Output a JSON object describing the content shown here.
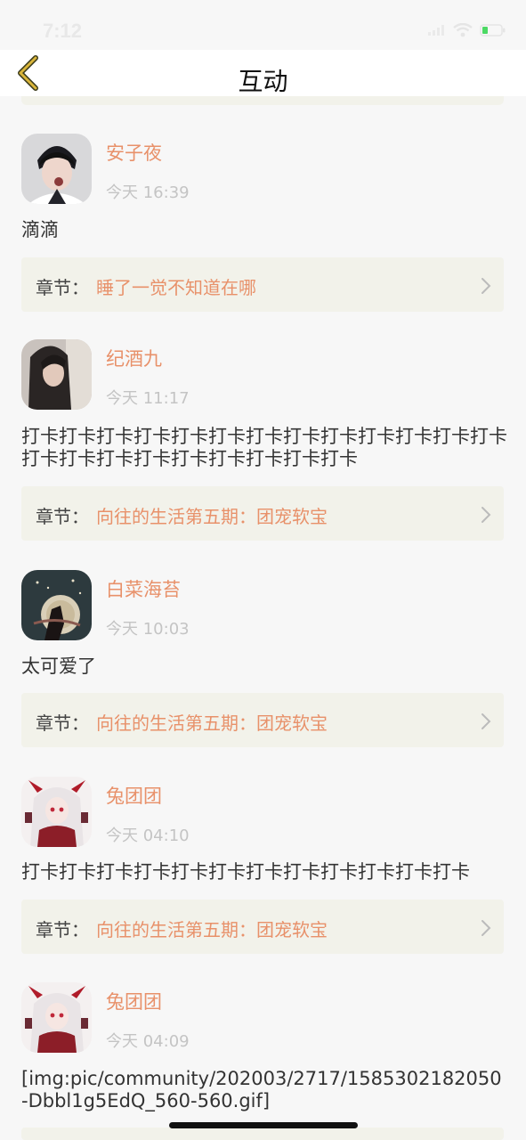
{
  "status_bar": {
    "time": "7:12"
  },
  "nav": {
    "title": "互动",
    "back_icon": "chevron-left-icon"
  },
  "posts": [
    {
      "username": "安子夜",
      "time": "今天 16:39",
      "content": "滴滴",
      "chapter_label": "章节：",
      "chapter_title": "睡了一觉不知道在哪"
    },
    {
      "username": "纪酒九",
      "time": "今天 11:17",
      "content": "打卡打卡打卡打卡打卡打卡打卡打卡打卡打卡打卡打卡打卡打卡打卡打卡打卡打卡打卡打卡打卡打卡",
      "chapter_label": "章节：",
      "chapter_title": "向往的生活第五期：团宠软宝"
    },
    {
      "username": "白菜海苔",
      "time": "今天 10:03",
      "content": "太可爱了",
      "chapter_label": "章节：",
      "chapter_title": "向往的生活第五期：团宠软宝"
    },
    {
      "username": "兔团团",
      "time": "今天 04:10",
      "content": "打卡打卡打卡打卡打卡打卡打卡打卡打卡打卡打卡打卡",
      "chapter_label": "章节：",
      "chapter_title": "向往的生活第五期：团宠软宝"
    },
    {
      "username": "兔团团",
      "time": "今天 04:09",
      "content": "[img:pic/community/202003/2717/1585302182050-Dbbl1g5EdQ_560-560.gif]",
      "chapter_label": "",
      "chapter_title": ""
    }
  ],
  "colors": {
    "accent": "#e8916a",
    "chapter_bg": "#f2f2ea",
    "time_gray": "#c4c4c4",
    "back_arrow": "#d9b53a"
  }
}
